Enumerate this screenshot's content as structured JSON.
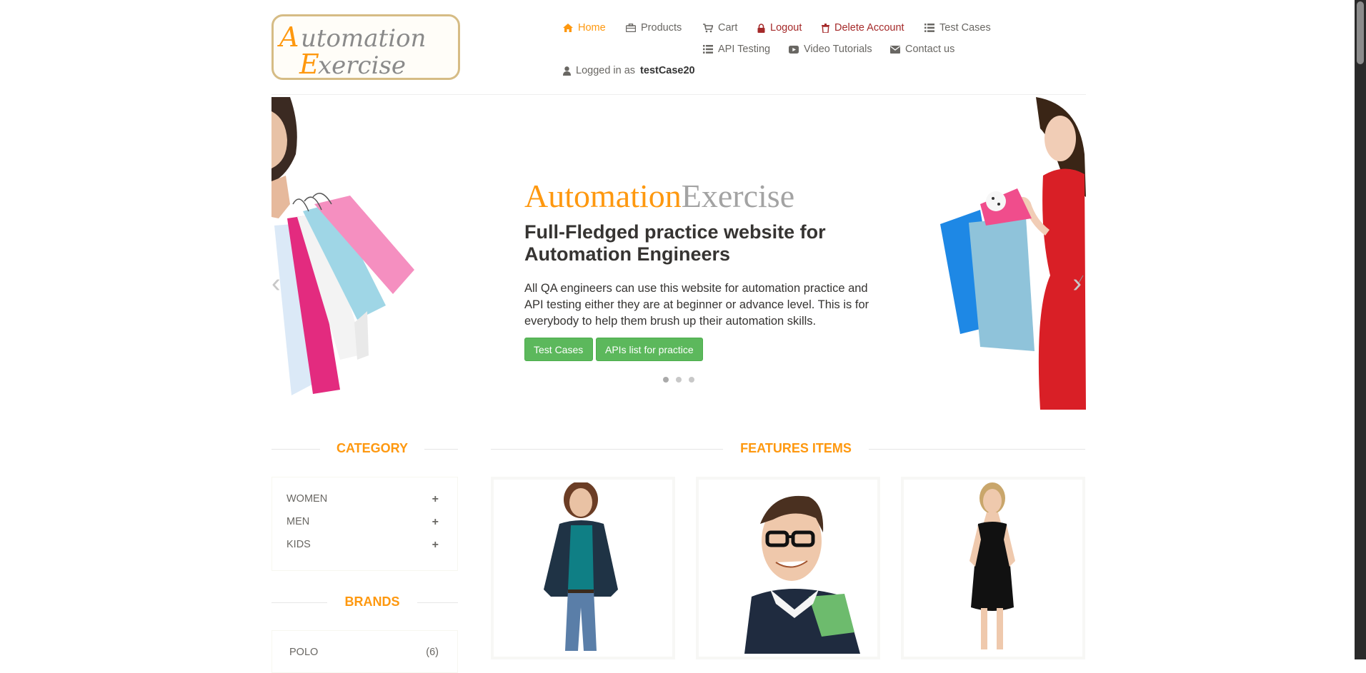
{
  "logo": {
    "line1": "Automation",
    "line2": "Exercise"
  },
  "nav": {
    "home": "Home",
    "products": "Products",
    "cart": "Cart",
    "logout": "Logout",
    "delete_account": "Delete Account",
    "test_cases": "Test Cases",
    "api_testing": "API Testing",
    "video_tutorials": "Video Tutorials",
    "contact_us": "Contact us",
    "logged_in_prefix": "Logged in as",
    "username": "testCase20"
  },
  "slider": {
    "brand_part1": "Automation",
    "brand_part2": "Exercise",
    "heading": "Full-Fledged practice website for Automation Engineers",
    "text": "All QA engineers can use this website for automation practice and API testing either they are at beginner or advance level. This is for everybody to help them brush up their automation skills.",
    "btn_test_cases": "Test Cases",
    "btn_apis": "APIs list for practice",
    "slide_count": 3,
    "active_slide": 1
  },
  "sidebar": {
    "category_title": "CATEGORY",
    "categories": [
      {
        "label": "WOMEN",
        "toggle": "+"
      },
      {
        "label": "MEN",
        "toggle": "+"
      },
      {
        "label": "KIDS",
        "toggle": "+"
      }
    ],
    "brands_title": "BRANDS",
    "brands": [
      {
        "label": "POLO",
        "count": "(6)"
      }
    ]
  },
  "main": {
    "features_title": "FEATURES ITEMS"
  },
  "colors": {
    "accent": "#FE980F",
    "danger": "#a52a2a",
    "button_green": "#5cb85c",
    "text": "#696763"
  }
}
